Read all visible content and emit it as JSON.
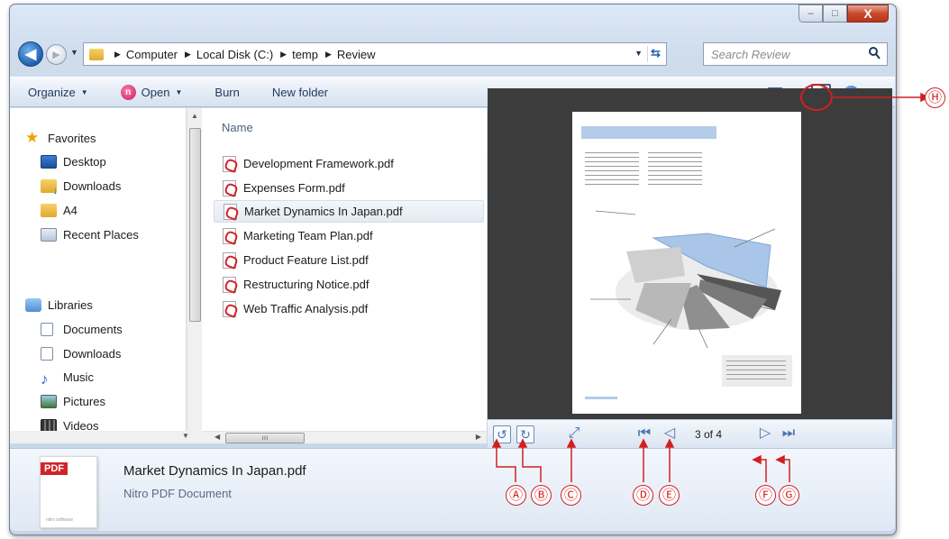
{
  "window": {
    "controls": {
      "minimize": "–",
      "maximize": "□",
      "close": "X"
    }
  },
  "address": {
    "crumbs": [
      "Computer",
      "Local Disk (C:)",
      "temp",
      "Review"
    ],
    "search_placeholder": "Search Review"
  },
  "toolbar": {
    "organize": "Organize",
    "open": "Open",
    "burn": "Burn",
    "new_folder": "New folder"
  },
  "nav": {
    "favorites_label": "Favorites",
    "favorites": [
      "Desktop",
      "Downloads",
      "A4",
      "Recent Places"
    ],
    "libraries_label": "Libraries",
    "libraries": [
      "Documents",
      "Downloads",
      "Music",
      "Pictures",
      "Videos"
    ]
  },
  "files": {
    "column": "Name",
    "items": [
      "Development Framework.pdf",
      "Expenses Form.pdf",
      "Market Dynamics In Japan.pdf",
      "Marketing Team Plan.pdf",
      "Product Feature List.pdf",
      "Restructuring Notice.pdf",
      "Web Traffic Analysis.pdf"
    ],
    "selected": "Market Dynamics In Japan.pdf"
  },
  "preview": {
    "page_indicator": "3 of 4"
  },
  "details": {
    "badge": "PDF",
    "file_name": "Market Dynamics In Japan.pdf",
    "file_type": "Nitro PDF Document"
  },
  "callouts": {
    "A": "Ⓐ",
    "B": "Ⓑ",
    "C": "Ⓒ",
    "D": "Ⓓ",
    "E": "Ⓔ",
    "F": "Ⓕ",
    "G": "Ⓖ",
    "H": "Ⓗ",
    "color": "#d21f1f"
  }
}
